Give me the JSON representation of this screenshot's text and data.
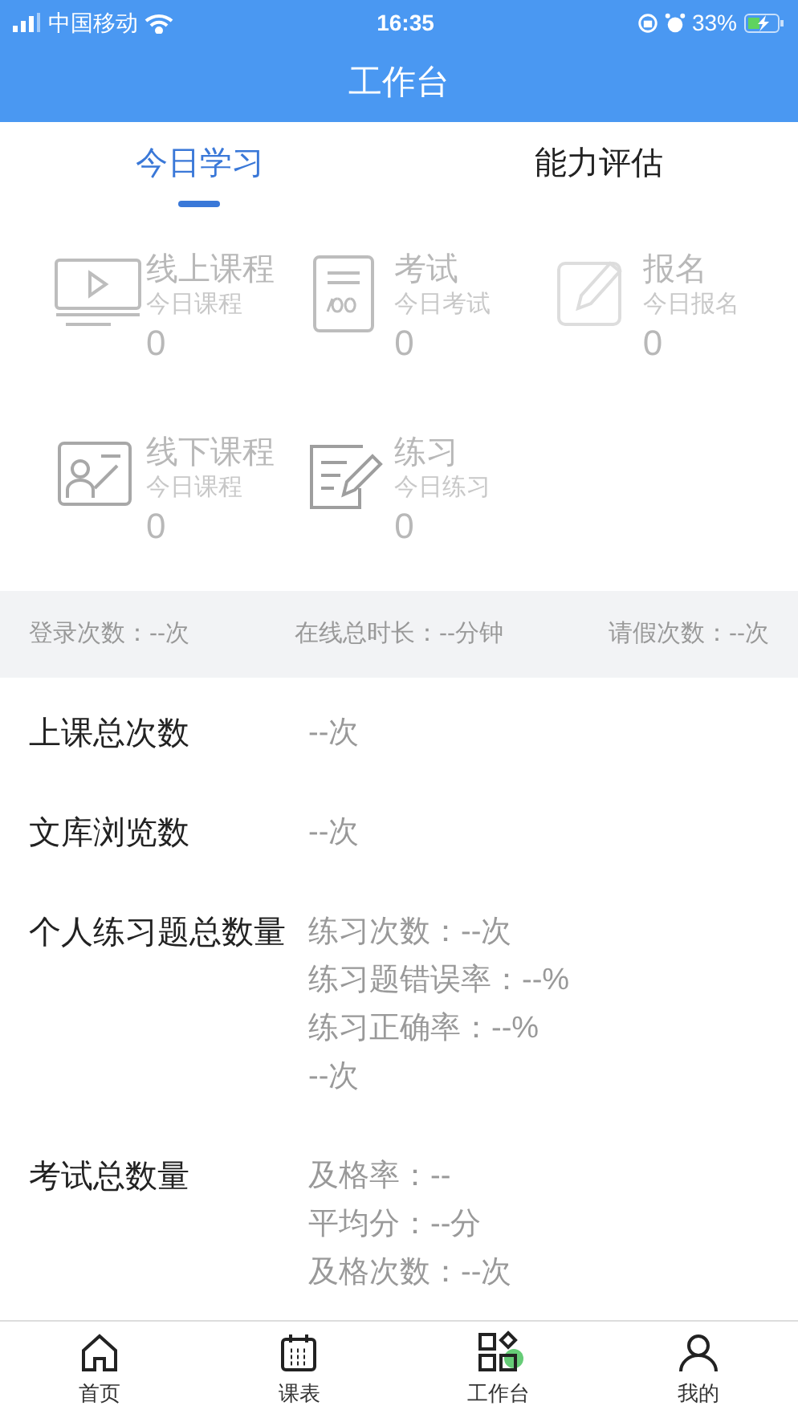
{
  "status_bar": {
    "carrier": "中国移动",
    "time": "16:35",
    "battery": "33%"
  },
  "header": {
    "title": "工作台"
  },
  "tabs": [
    {
      "label": "今日学习",
      "selected": true
    },
    {
      "label": "能力评估",
      "selected": false
    }
  ],
  "today_items": [
    {
      "kind": "video",
      "title": "线上课程",
      "subtitle": "今日课程",
      "count": "0"
    },
    {
      "kind": "exam",
      "title": "考试",
      "subtitle": "今日考试",
      "count": "0"
    },
    {
      "kind": "signup",
      "title": "报名",
      "subtitle": "今日报名",
      "count": "0"
    },
    {
      "kind": "classroom",
      "title": "线下课程",
      "subtitle": "今日课程",
      "count": "0"
    },
    {
      "kind": "practice",
      "title": "练习",
      "subtitle": "今日练习",
      "count": "0"
    }
  ],
  "summary": [
    "登录次数：--次",
    "在线总时长：--分钟",
    "请假次数：--次"
  ],
  "stats": [
    {
      "label": "上课总次数",
      "values": [
        "--次"
      ]
    },
    {
      "label": "文库浏览数",
      "values": [
        "--次"
      ]
    },
    {
      "label": "个人练习题总数量",
      "values": [
        "练习次数：--次",
        "练习题错误率：--%",
        "练习正确率：--%",
        "--次"
      ]
    },
    {
      "label": "考试总数量",
      "values": [
        "及格率：--",
        "平均分：--分",
        "及格次数：--次"
      ]
    }
  ],
  "tab_bar": [
    {
      "kind": "home",
      "label": "首页"
    },
    {
      "kind": "calendar",
      "label": "课表"
    },
    {
      "kind": "workbench",
      "label": "工作台"
    },
    {
      "kind": "user",
      "label": "我的"
    }
  ]
}
